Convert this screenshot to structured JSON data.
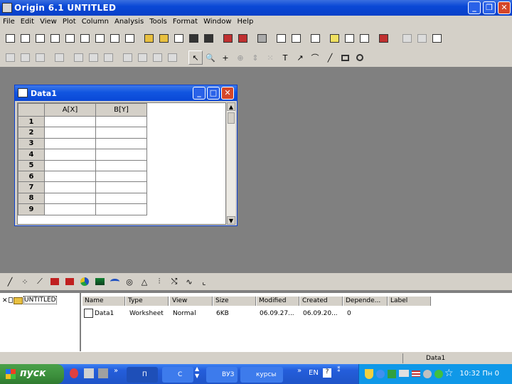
{
  "window": {
    "title": "Origin 6.1  UNTITLED"
  },
  "menu": [
    "File",
    "Edit",
    "View",
    "Plot",
    "Column",
    "Analysis",
    "Tools",
    "Format",
    "Window",
    "Help"
  ],
  "worksheet": {
    "title": "Data1",
    "columns": [
      "A[X]",
      "B[Y]"
    ],
    "rows": [
      "1",
      "2",
      "3",
      "4",
      "5",
      "6",
      "7",
      "8",
      "9"
    ]
  },
  "explorer": {
    "folder": "UNTITLED",
    "headers": [
      "Name",
      "Type",
      "View",
      "Size",
      "Modified",
      "Created",
      "Depende...",
      "Label"
    ],
    "items": [
      {
        "name": "Data1",
        "type": "Worksheet",
        "view": "Normal",
        "size": "6KB",
        "modified": "06.09.27...",
        "created": "06.09.20...",
        "dependents": "0",
        "label": ""
      }
    ]
  },
  "status": {
    "active": "Data1"
  },
  "taskbar": {
    "start": "пуск",
    "tasks": [
      "П",
      "С",
      "ВУЗ",
      "курсы"
    ],
    "lang": "EN",
    "clock": "10:32 Пн 0"
  }
}
